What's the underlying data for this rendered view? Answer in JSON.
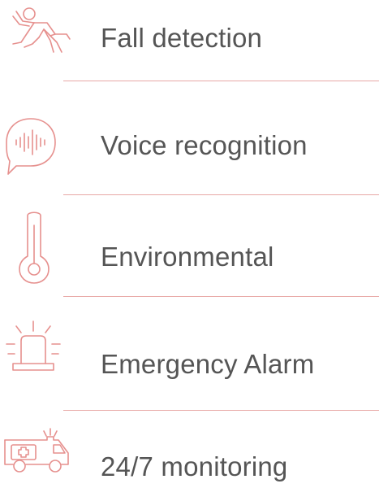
{
  "features": [
    {
      "label": "Fall detection",
      "icon": "falling-person-icon"
    },
    {
      "label": "Voice recognition",
      "icon": "voice-bubble-icon"
    },
    {
      "label": "Environmental",
      "icon": "thermometer-icon"
    },
    {
      "label": "Emergency Alarm",
      "icon": "siren-alarm-icon"
    },
    {
      "label": "24/7 monitoring",
      "icon": "ambulance-icon"
    }
  ],
  "colors": {
    "accent": "#e6908e",
    "divider": "#e8a8a6",
    "text": "#555555",
    "background": "#ffffff"
  }
}
